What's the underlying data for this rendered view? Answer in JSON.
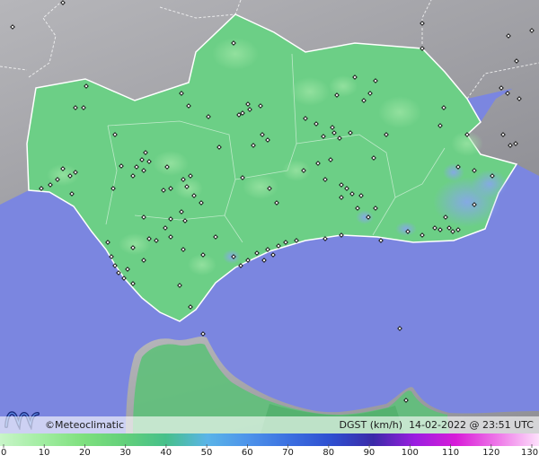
{
  "credit": {
    "symbol": "©",
    "name": "Meteoclimatic"
  },
  "caption": {
    "variable": "DGST (km/h)",
    "datetime": "14-02-2022 @ 23:51 UTC"
  },
  "colors": {
    "sea": "#7b86e0",
    "land_outside": "#a8a8ac",
    "region_fill": "#6ccf86",
    "region_dark": "#4fb06c",
    "calm_blue": "#86a8e8",
    "station_marker": "#111111"
  },
  "icons": {
    "logo": "meteoclimatic-m-logo",
    "station": "station-diamond-marker"
  },
  "legend": {
    "ticks": [
      0,
      10,
      20,
      30,
      40,
      50,
      60,
      70,
      80,
      90,
      100,
      110,
      120,
      130
    ],
    "tick_labels": [
      "0",
      "10",
      "20",
      "30",
      "40",
      "50",
      "60",
      "70",
      "80",
      "90",
      "100",
      "110",
      "120",
      "130"
    ],
    "color_stops": [
      {
        "v": 0,
        "c": "#c8f5c8"
      },
      {
        "v": 10,
        "c": "#a2eda2"
      },
      {
        "v": 20,
        "c": "#7ee07e"
      },
      {
        "v": 30,
        "c": "#63d07a"
      },
      {
        "v": 40,
        "c": "#46c08a"
      },
      {
        "v": 50,
        "c": "#5ab4e8"
      },
      {
        "v": 60,
        "c": "#4d93ea"
      },
      {
        "v": 70,
        "c": "#3b6fe0"
      },
      {
        "v": 80,
        "c": "#2f4fd0"
      },
      {
        "v": 90,
        "c": "#3a2aa8"
      },
      {
        "v": 100,
        "c": "#9a1ee0"
      },
      {
        "v": 110,
        "c": "#d81cd8"
      },
      {
        "v": 120,
        "c": "#ee78e8"
      },
      {
        "v": 130,
        "c": "#fde0fb"
      }
    ]
  }
}
